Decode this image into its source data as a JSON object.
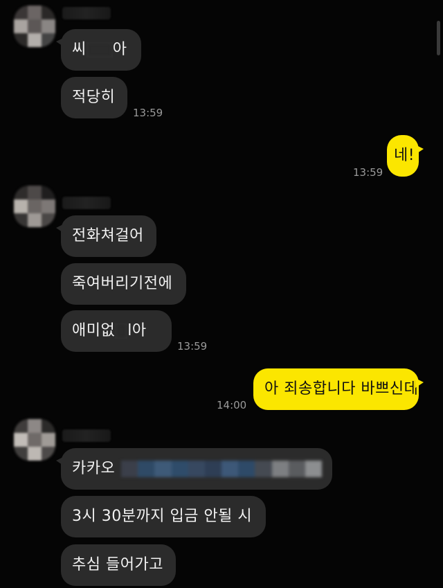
{
  "chat": {
    "groups": [
      {
        "messages": [
          {
            "text_a": "씨",
            "text_b": "아"
          },
          {
            "text": "적당히"
          }
        ],
        "time": "13:59"
      },
      {
        "sent_text": "네!",
        "time": "13:59"
      },
      {
        "messages": [
          {
            "text": "전화쳐걸어"
          },
          {
            "text": "죽여버리기전에"
          },
          {
            "text_a": "애미없",
            "text_b": "l아"
          }
        ],
        "time": "13:59"
      },
      {
        "sent_text": "아 죄송합니다 바쁘신데",
        "time": "14:00"
      },
      {
        "messages": [
          {
            "text": "카카오"
          },
          {
            "text": "3시 30분까지 입금 안될 시"
          },
          {
            "text": "추심 들어가고"
          }
        ]
      }
    ]
  },
  "colors": {
    "background": "#050505",
    "received_bubble": "#2b2b2b",
    "sent_bubble": "#fbe600",
    "timestamp": "#9a9a9a"
  },
  "icons": [
    "blurred-avatar",
    "redaction-blur"
  ]
}
